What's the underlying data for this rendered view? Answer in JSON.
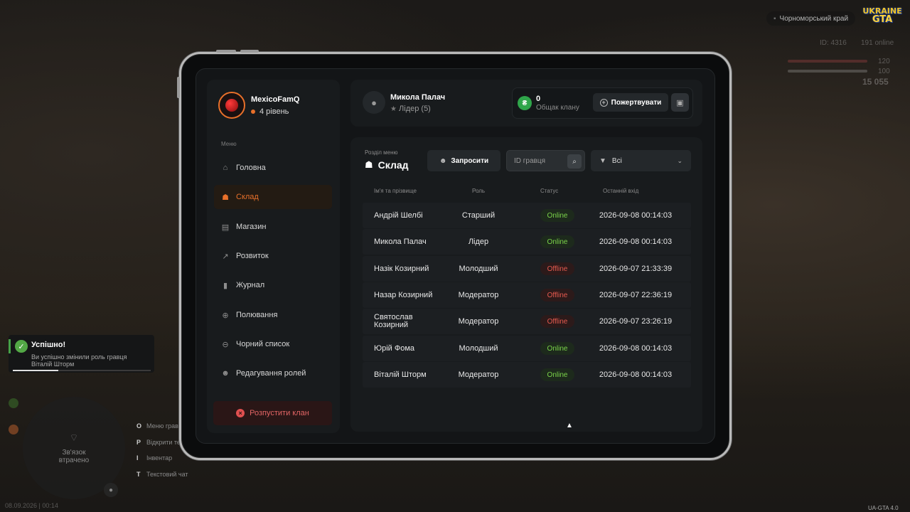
{
  "hud": {
    "region": "Чорноморський край",
    "logo_top": "UKRAINE",
    "logo_bottom": "GTA",
    "player_id": "ID: 4316",
    "online": "191 online",
    "health": "120",
    "armor": "100",
    "money": "15 055",
    "minimap_text": "Зв'язок втрачено",
    "keys": [
      {
        "key": "O",
        "label": "Меню гравця"
      },
      {
        "key": "P",
        "label": "Відкрити телефон"
      },
      {
        "key": "I",
        "label": "Інвентар"
      },
      {
        "key": "T",
        "label": "Текстовий чат"
      }
    ],
    "datetime": "08.09.2026 | 00:14",
    "version": "UA-GTA 4.0"
  },
  "toast": {
    "title": "Успішно!",
    "message": "Ви успішно змінили роль гравця Віталій Шторм",
    "progress": 0.33
  },
  "sidebar": {
    "clan_name": "MexicoFamQ",
    "level": "4 рівень",
    "menu_label": "Меню",
    "items": [
      {
        "label": "Головна",
        "icon": "home-icon",
        "glyph": "⌂",
        "active": false
      },
      {
        "label": "Склад",
        "icon": "members-icon",
        "glyph": "☗",
        "active": true
      },
      {
        "label": "Магазин",
        "icon": "shop-icon",
        "glyph": "▤",
        "active": false
      },
      {
        "label": "Розвиток",
        "icon": "chart-icon",
        "glyph": "↗",
        "active": false
      },
      {
        "label": "Журнал",
        "icon": "book-icon",
        "glyph": "▮",
        "active": false
      },
      {
        "label": "Полювання",
        "icon": "crosshair-icon",
        "glyph": "⊕",
        "active": false
      },
      {
        "label": "Чорний список",
        "icon": "ban-icon",
        "glyph": "⊖",
        "active": false
      },
      {
        "label": "Редагування ролей",
        "icon": "user-edit-icon",
        "glyph": "☻",
        "active": false
      }
    ],
    "disband_label": "Розпустити клан"
  },
  "header": {
    "user_name": "Микола Палач",
    "user_role": "Лідер (5)",
    "balance": "0",
    "balance_label": "Общак клану",
    "donate_label": "Пожертвувати"
  },
  "main": {
    "section_label": "Розділ меню",
    "section_title": "Склад",
    "invite_label": "Запросити",
    "search_placeholder": "ID гравця",
    "filter_value": "Всі",
    "columns": [
      "Ім'я та прізвище",
      "Роль",
      "Статус",
      "Останній вхід"
    ],
    "rows": [
      {
        "name": "Андрій Шелбі",
        "role": "Старший",
        "status": "Online",
        "online": true,
        "last": "2026-09-08 00:14:03"
      },
      {
        "name": "Микола Палач",
        "role": "Лідер",
        "status": "Online",
        "online": true,
        "last": "2026-09-08 00:14:03"
      },
      {
        "name": "Назік Козирний",
        "role": "Молодший",
        "status": "Offline",
        "online": false,
        "last": "2026-09-07 21:33:39"
      },
      {
        "name": "Назар Козирний",
        "role": "Модератор",
        "status": "Offline",
        "online": false,
        "last": "2026-09-07 22:36:19"
      },
      {
        "name": "Святослав Козирний",
        "role": "Модератор",
        "status": "Offline",
        "online": false,
        "last": "2026-09-07 23:26:19"
      },
      {
        "name": "Юрій Фома",
        "role": "Молодший",
        "status": "Online",
        "online": true,
        "last": "2026-09-08 00:14:03"
      },
      {
        "name": "Віталій Шторм",
        "role": "Модератор",
        "status": "Online",
        "online": true,
        "last": "2026-09-08 00:14:03"
      }
    ]
  },
  "colors": {
    "accent": "#e8702a",
    "online": "#7bd44a",
    "offline": "#e65a4f",
    "success": "#53a846"
  }
}
